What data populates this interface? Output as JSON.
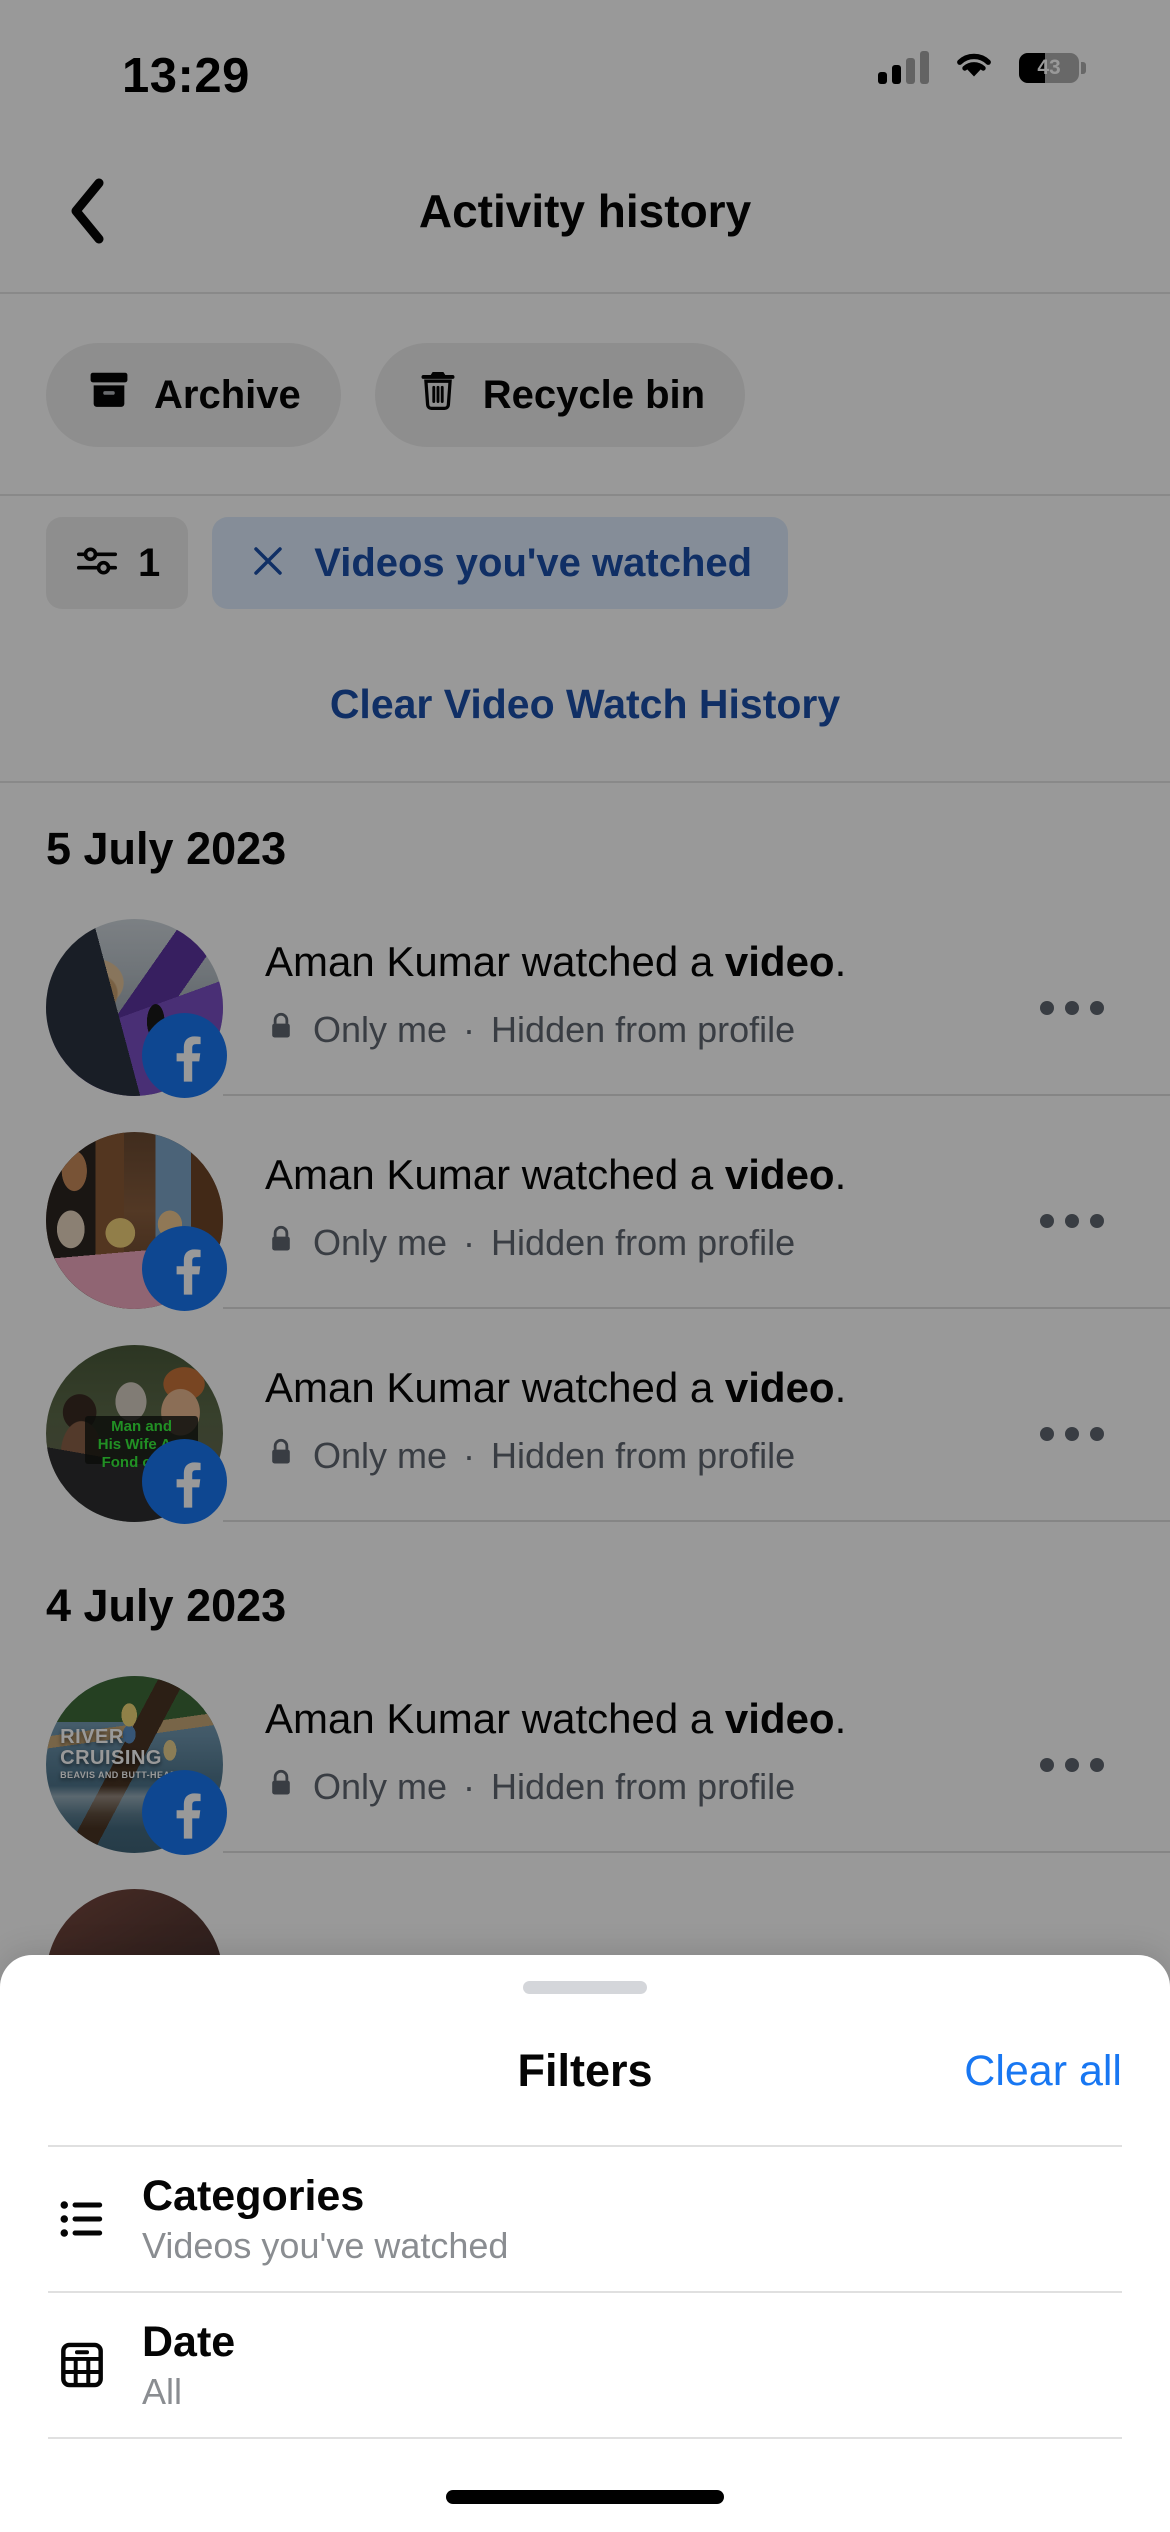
{
  "status_bar": {
    "time": "13:29",
    "signal_icon": "cellular-signal-icon",
    "signal_bars_filled": 2,
    "signal_bars_total": 4,
    "wifi_icon": "wifi-icon",
    "battery_icon": "battery-icon",
    "battery_percent": "43",
    "battery_level": 43
  },
  "nav": {
    "back_icon": "chevron-left-icon",
    "title": "Activity history"
  },
  "quick_actions": [
    {
      "label": "Archive",
      "icon": "archive-box-icon"
    },
    {
      "label": "Recycle bin",
      "icon": "trash-icon"
    }
  ],
  "filter_row": {
    "filter_icon": "sliders-filter-icon",
    "filter_count": "1",
    "active_chip": {
      "label": "Videos you've watched",
      "remove_icon": "close-x-icon"
    }
  },
  "clear_history": {
    "label": "Clear Video Watch History"
  },
  "feed": {
    "groups": [
      {
        "date": "5 July 2023",
        "rows": [
          {
            "actor": "Aman Kumar",
            "action_prefix": "Aman Kumar watched a ",
            "action_object": "video",
            "action_suffix": ".",
            "privacy_icon": "lock-icon",
            "privacy": "Only me",
            "separator": "·",
            "visibility": "Hidden from profile",
            "menu_icon": "ellipsis-horizontal-icon",
            "thumbnail": "street-interview-purple-jacket",
            "badge_icon": "facebook-icon"
          },
          {
            "actor": "Aman Kumar",
            "action_prefix": "Aman Kumar watched a ",
            "action_object": "video",
            "action_suffix": ".",
            "privacy_icon": "lock-icon",
            "privacy": "Only me",
            "separator": "·",
            "visibility": "Hidden from profile",
            "menu_icon": "ellipsis-horizontal-icon",
            "thumbnail": "cartoon-reaction-collage",
            "badge_icon": "facebook-icon"
          },
          {
            "actor": "Aman Kumar",
            "action_prefix": "Aman Kumar watched a ",
            "action_object": "video",
            "action_suffix": ".",
            "privacy_icon": "lock-icon",
            "privacy": "Only me",
            "separator": "·",
            "visibility": "Hidden from profile",
            "menu_icon": "ellipsis-horizontal-icon",
            "thumbnail": "man-and-his-wife-are-fond-of-me",
            "thumbnail_caption": "Man and\nHis Wife Are\nFond of Me",
            "badge_icon": "facebook-icon"
          }
        ]
      },
      {
        "date": "4 July 2023",
        "rows": [
          {
            "actor": "Aman Kumar",
            "action_prefix": "Aman Kumar watched a ",
            "action_object": "video",
            "action_suffix": ".",
            "privacy_icon": "lock-icon",
            "privacy": "Only me",
            "separator": "·",
            "visibility": "Hidden from profile",
            "menu_icon": "ellipsis-horizontal-icon",
            "thumbnail": "river-cruising-beavis-and-butt-head",
            "thumbnail_caption_1": "RIVER",
            "thumbnail_caption_2": "CRUISING",
            "thumbnail_caption_3": "BEAVIS AND BUTT-HEAD",
            "badge_icon": "facebook-icon"
          }
        ]
      }
    ]
  },
  "filters_sheet": {
    "grabber": "sheet-grabber-handle",
    "title": "Filters",
    "clear_all_label": "Clear all",
    "items": [
      {
        "icon": "bullet-list-icon",
        "label": "Categories",
        "value": "Videos you've watched"
      },
      {
        "icon": "calendar-grid-icon",
        "label": "Date",
        "value": "All"
      }
    ]
  },
  "colors": {
    "facebook_blue": "#1877F2",
    "link_blue": "#1b4fa8",
    "clear_all_blue": "#1877F2",
    "chip_background": "rgba(24,119,242,0.14)",
    "text_primary": "#050505",
    "text_secondary": "#606770",
    "text_muted": "#8a8d91",
    "sheet_background": "#ffffff",
    "dim_overlay": "rgba(0,0,0,0.40)"
  }
}
